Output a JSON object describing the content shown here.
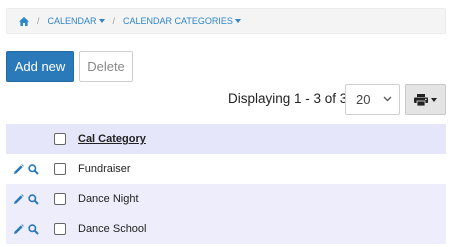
{
  "breadcrumb": {
    "home_icon": "home-icon",
    "items": [
      {
        "label": "CALENDAR"
      },
      {
        "label": "CALENDAR CATEGORIES"
      }
    ],
    "separator": "/"
  },
  "toolbar": {
    "add_label": "Add new",
    "delete_label": "Delete"
  },
  "pagination": {
    "displaying_text": "Displaying 1 - 3 of 3",
    "page_size": "20"
  },
  "table": {
    "columns": [
      {
        "label": "Cal Category"
      }
    ],
    "rows": [
      {
        "category": "Fundraiser"
      },
      {
        "category": "Dance Night"
      },
      {
        "category": "Dance School"
      }
    ]
  },
  "colors": {
    "accent": "#2a7ab9",
    "header_bg": "#e6e6fb",
    "stripe_bg": "#ededfb"
  }
}
